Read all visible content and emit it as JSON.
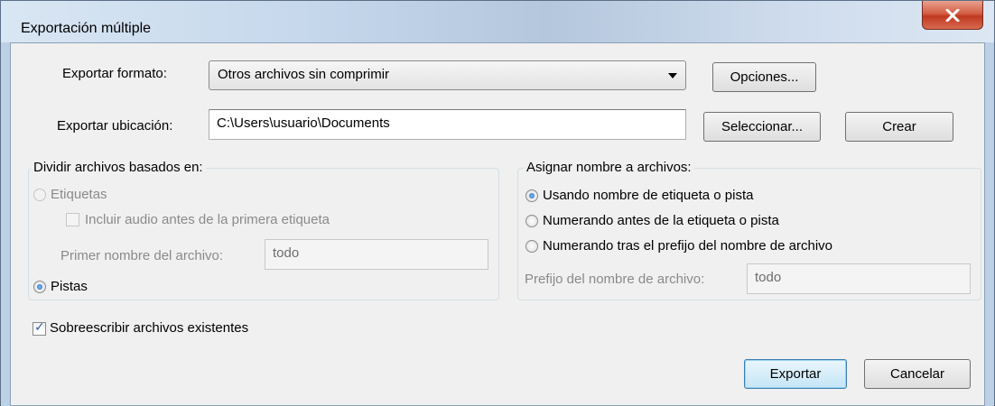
{
  "window": {
    "title": "Exportación múltiple",
    "close_glyph": "X"
  },
  "format": {
    "label": "Exportar formato:",
    "value": "Otros archivos sin comprimir",
    "options_button": "Opciones..."
  },
  "location": {
    "label": "Exportar ubicación:",
    "value": "C:\\Users\\usuario\\Documents",
    "select_button": "Seleccionar...",
    "create_button": "Crear"
  },
  "split": {
    "title": "Dividir archivos basados en:",
    "labels_option": "Etiquetas",
    "include_audio": "Incluir audio antes de la primera etiqueta",
    "first_name_label": "Primer nombre del archivo:",
    "first_name_value": "todo",
    "tracks_option": "Pistas",
    "selected": "Pistas"
  },
  "naming": {
    "title": "Asignar nombre a archivos:",
    "option_label_name": "Usando nombre de etiqueta o pista",
    "option_number_before": "Numerando antes de la etiqueta o pista",
    "option_number_prefix": "Numerando tras el prefijo del nombre de archivo",
    "prefix_label": "Prefijo del nombre de archivo:",
    "prefix_value": "todo",
    "selected": "Usando nombre de etiqueta o pista"
  },
  "overwrite": {
    "label": "Sobreescribir archivos existentes",
    "checked": true
  },
  "actions": {
    "export": "Exportar",
    "cancel": "Cancelar"
  },
  "colors": {
    "title_bar": "#c6d8ec",
    "dialog_bg": "#f0f0f0",
    "close_button": "#c0391f",
    "disabled_text": "#8a8a8a"
  }
}
